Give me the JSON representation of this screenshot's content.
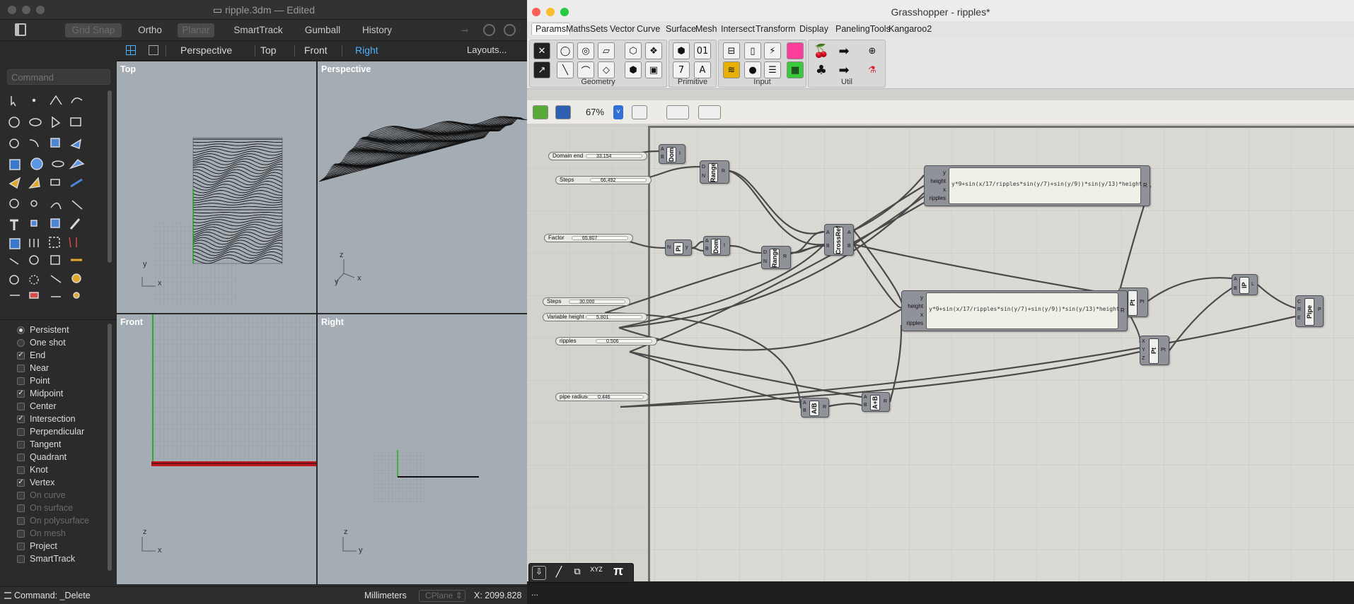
{
  "rhino": {
    "window_title": "ripple.3dm",
    "window_state": "— Edited",
    "toolbar": [
      "Grid Snap",
      "Ortho",
      "Planar",
      "SmartTrack",
      "Gumball",
      "History"
    ],
    "view_tabs": [
      "Perspective",
      "Top",
      "Front",
      "Right"
    ],
    "active_view_tab": "Right",
    "layouts_label": "Layouts...",
    "command_placeholder": "Command",
    "viewports": {
      "top": "Top",
      "perspective": "Perspective",
      "front": "Front",
      "right": "Right"
    },
    "axes": {
      "x": "x",
      "y": "y",
      "z": "z"
    },
    "osnap_modes": {
      "persistent": "Persistent",
      "one_shot": "One shot"
    },
    "osnaps": [
      {
        "label": "End",
        "checked": true,
        "enabled": true
      },
      {
        "label": "Near",
        "checked": false,
        "enabled": true
      },
      {
        "label": "Point",
        "checked": false,
        "enabled": true
      },
      {
        "label": "Midpoint",
        "checked": true,
        "enabled": true
      },
      {
        "label": "Center",
        "checked": false,
        "enabled": true
      },
      {
        "label": "Intersection",
        "checked": true,
        "enabled": true
      },
      {
        "label": "Perpendicular",
        "checked": false,
        "enabled": true
      },
      {
        "label": "Tangent",
        "checked": false,
        "enabled": true
      },
      {
        "label": "Quadrant",
        "checked": false,
        "enabled": true
      },
      {
        "label": "Knot",
        "checked": false,
        "enabled": true
      },
      {
        "label": "Vertex",
        "checked": true,
        "enabled": true
      },
      {
        "label": "On curve",
        "checked": false,
        "enabled": false
      },
      {
        "label": "On surface",
        "checked": false,
        "enabled": false
      },
      {
        "label": "On polysurface",
        "checked": false,
        "enabled": false
      },
      {
        "label": "On mesh",
        "checked": false,
        "enabled": false
      },
      {
        "label": "Project",
        "checked": false,
        "enabled": true
      },
      {
        "label": "SmartTrack",
        "checked": false,
        "enabled": true
      }
    ],
    "status": {
      "command": "Command: _Delete",
      "units": "Millimeters",
      "cplane": "CPlane",
      "coord": "X: 2099.828"
    }
  },
  "grasshopper": {
    "window_title": "Grasshopper - ripples*",
    "tabs": [
      "Params",
      "Maths",
      "Sets",
      "Vector",
      "Curve",
      "Surface",
      "Mesh",
      "Intersect",
      "Transform",
      "Display",
      "PanelingTools",
      "Kangaroo2"
    ],
    "active_tab": "Params",
    "ribbon_groups": [
      "Geometry",
      "Primitive",
      "Input",
      "Util"
    ],
    "primitive_icons": {
      "number": "7",
      "text": "A"
    },
    "zoom": "67%",
    "sliders": [
      {
        "name": "Domain end",
        "value": "33.154"
      },
      {
        "name": "Steps",
        "value": "66.492"
      },
      {
        "name": "Factor",
        "value": "65.807"
      },
      {
        "name": "Steps",
        "value": "30.000"
      },
      {
        "name": "Variable height",
        "value": "5.801"
      },
      {
        "name": "ripples",
        "value": "0.506"
      },
      {
        "name": "pipe radius",
        "value": "0.446"
      }
    ],
    "components": {
      "dom1": "Dom",
      "range1": "Range",
      "pi": "Pi",
      "dom2": "Dom",
      "range2": "Range",
      "crossref": "CrossRef",
      "pt1": "Pt",
      "pt2": "Pt",
      "div": "A/B",
      "add": "A+B",
      "ip": "IP",
      "pipe": "Pipe"
    },
    "expression": {
      "formula": "y*9+sin(x/17/ripples*sin(y/7)+sin(y/9))*sin(y/13)*height",
      "inputs": [
        "y",
        "height",
        "x",
        "ripples"
      ],
      "output": "R"
    },
    "pins": {
      "A": "A",
      "B": "B",
      "D": "D",
      "N": "N",
      "R": "R",
      "X": "X",
      "Y": "Y",
      "Z": "Z",
      "Pt": "Pt",
      "C": "C",
      "E": "E",
      "P": "P",
      "L": "L",
      "I": "I"
    },
    "status": "..."
  },
  "colors": {
    "rhino_bg": "#2b2b2b",
    "viewport_bg": "#a5adb4",
    "active_tab": "#4db0ff",
    "gh_canvas": "#d4d2cc",
    "component": "#8f9399",
    "wire": "#4a4a4a"
  }
}
